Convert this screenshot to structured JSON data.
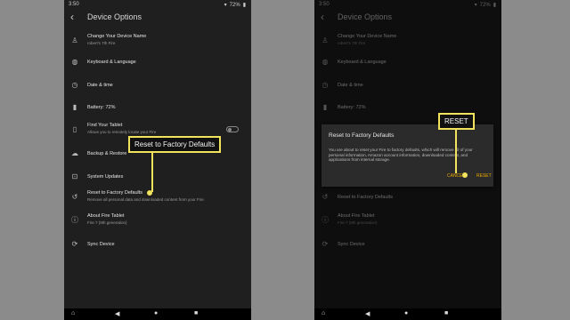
{
  "status": {
    "time": "3:50",
    "battery": "72%"
  },
  "header": {
    "title": "Device Options"
  },
  "items": [
    {
      "label": "Change Your Device Name",
      "sub": "robert's 7th Fire",
      "icon": "person-icon"
    },
    {
      "label": "Keyboard & Language",
      "sub": "",
      "icon": "globe-icon"
    },
    {
      "label": "Date & time",
      "sub": "",
      "icon": "clock-icon"
    },
    {
      "label": "Battery: 72%",
      "sub": "",
      "icon": "battery-icon"
    },
    {
      "label": "Find Your Tablet",
      "sub": "Allows you to remotely locate your Fire",
      "icon": "phone-icon"
    },
    {
      "label": "Backup & Restore",
      "sub": "",
      "icon": "cloud-icon"
    },
    {
      "label": "System Updates",
      "sub": "",
      "icon": "update-icon"
    },
    {
      "label": "Reset to Factory Defaults",
      "sub": "Remove all personal data and downloaded content from your Fire.",
      "icon": "reset-icon"
    },
    {
      "label": "About Fire Tablet",
      "sub": "Fire 7 (9th generation)",
      "icon": "info-icon"
    },
    {
      "label": "Sync Device",
      "sub": "",
      "icon": "sync-icon"
    }
  ],
  "callouts": {
    "left": "Reset to Factory Defaults",
    "right": "RESET"
  },
  "dialog": {
    "title": "Reset to Factory Defaults",
    "body": "You are about to reset your Fire to factory defaults, which will remove all of your personal information, Amazon account information, downloaded content, and applications from internal storage.",
    "cancel": "CANCEL",
    "reset": "RESET"
  },
  "colors": {
    "highlight": "#f1e35b",
    "accent": "#f0a900",
    "panel": "#1f1f1f"
  }
}
